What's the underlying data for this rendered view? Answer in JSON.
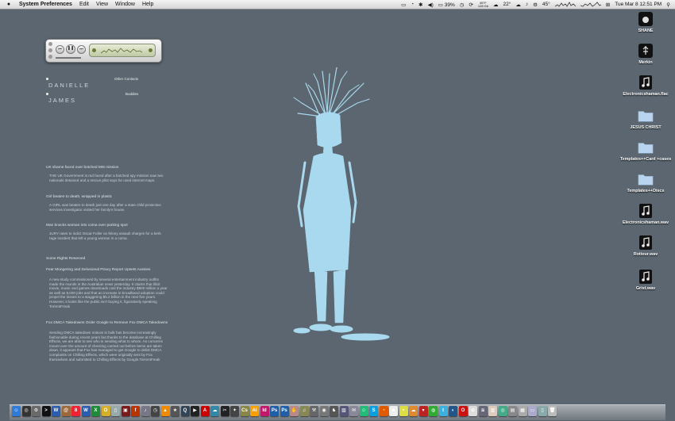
{
  "menubar": {
    "app_name": "System Preferences",
    "menus": [
      "Edit",
      "View",
      "Window",
      "Help"
    ],
    "battery_percent": "39%",
    "weather_temp": "22°",
    "temp_small": "45°",
    "clock": "Tue Mar 8  12:51 PM",
    "user_initial": "Q",
    "status_tiny_text": "85°F\n128 Gb"
  },
  "player": {
    "prev_label": "⏮",
    "play_label": "❚❚",
    "next_label": "⏭"
  },
  "contacts": [
    {
      "name": "DANIELLE",
      "group": "Other Contacts"
    },
    {
      "name": "JAMES",
      "group": "Buddies"
    }
  ],
  "news": [
    {
      "headline": "UK shame faced over botched MI6 mission",
      "body": "THE UK Government is red faced after a botched spy mission saw two nationals detained and a rescue pilot says he used internet maps."
    },
    {
      "headline": "Girl beaten to death, wrapped in plastic",
      "body": "A GIRL&nbsp;was beaten to death just one day after a state child protective services investigator visited her family's house."
    },
    {
      "headline": "Man knocks woman into coma over parking spot",
      "body": "JURY rates to indict Oscar Fuller on felony assault charges for a kerb rage incident that left a young woman in a coma."
    }
  ],
  "feed2": {
    "title": "Some Rights Reserved",
    "items": [
      {
        "headline": "Fear Mongering and Delusional Piracy Report Upsets Aussies",
        "body": "A new study commissioned by several entertainment industry outfits made the rounds in the Australian news yesterday. It claims that illicit movie, music and games downloads cost the industry $900 million a year as well as 8,000 jobs and that an increase in broadband adoption could propel the losses to a staggering $5.2 billion in the next five years. However, it looks like the public isn't buying it, figuratively speaking TorrentFreak"
      },
      {
        "headline": "Fox DMCA Takedowns Order Google to Remove Fox DMCA Takedowns",
        "body": "Sending DMCA takedown notices in bulk has become increasingly fashionable during recent years but thanks to the database at Chilling Effects, we are able to see who is sending what to whom. As concerns mount over the amount of checking carried out before items are taken down, it appears that Fox has managed to get Google to delist DMCA complaints on Chilling Effects, which were originally sent by Fox themselves and submitted to Chilling Effects by Google.TorrentFreak"
      }
    ]
  },
  "desktop_icons": [
    {
      "label": "SHANE",
      "icon": "apple-drive-icon"
    },
    {
      "label": "Merkin",
      "icon": "usb-drive-icon"
    },
    {
      "label": "Electronicshaman.flac",
      "icon": "audio-file-icon"
    },
    {
      "label": "JESUS CHRIST",
      "icon": "folder-icon"
    },
    {
      "label": "Templates++Card +cases",
      "icon": "folder-icon"
    },
    {
      "label": "Templates++Discs",
      "icon": "folder-icon"
    },
    {
      "label": "Electronicshaman.wav",
      "icon": "audio-file-icon"
    },
    {
      "label": "Rotteur.wav",
      "icon": "audio-file-icon"
    },
    {
      "label": "Grist.wav",
      "icon": "audio-file-icon"
    }
  ],
  "colors": {
    "desktop": "#5b6670",
    "figure": "#a9d9ee"
  },
  "dock": [
    {
      "name": "finder",
      "color": "#2f7bd8",
      "glyph": "☺"
    },
    {
      "name": "dashboard",
      "color": "#333",
      "glyph": "◎"
    },
    {
      "name": "system-preferences",
      "color": "#6a6a6a",
      "glyph": "⚙"
    },
    {
      "name": "terminal",
      "color": "#111",
      "glyph": ">"
    },
    {
      "name": "word",
      "color": "#2a5db0",
      "glyph": "W"
    },
    {
      "name": "address-book",
      "color": "#9c6a3a",
      "glyph": "@"
    },
    {
      "name": "ical",
      "color": "#e23",
      "glyph": "8"
    },
    {
      "name": "word-alt",
      "color": "#2a5db0",
      "glyph": "W"
    },
    {
      "name": "excel",
      "color": "#1f8a3a",
      "glyph": "X"
    },
    {
      "name": "ring",
      "color": "#d4b02a",
      "glyph": "O"
    },
    {
      "name": "ipod",
      "color": "#9aa",
      "glyph": "▯"
    },
    {
      "name": "photo-booth",
      "color": "#7a1a1a",
      "glyph": "▣"
    },
    {
      "name": "flash",
      "color": "#b30",
      "glyph": "f"
    },
    {
      "name": "itunes",
      "color": "#778",
      "glyph": "♪"
    },
    {
      "name": "time-machine",
      "color": "#444",
      "glyph": "◷"
    },
    {
      "name": "vlc",
      "color": "#f08a00",
      "glyph": "▲"
    },
    {
      "name": "imovie",
      "color": "#555",
      "glyph": "★"
    },
    {
      "name": "quicktime",
      "color": "#345",
      "glyph": "Q"
    },
    {
      "name": "app-dark",
      "color": "#222",
      "glyph": "▶"
    },
    {
      "name": "acrobat",
      "color": "#c00",
      "glyph": "A"
    },
    {
      "name": "skype-alt",
      "color": "#38a",
      "glyph": "☁"
    },
    {
      "name": "cut-app",
      "color": "#222",
      "glyph": "✂"
    },
    {
      "name": "star-app",
      "color": "#444",
      "glyph": "✦"
    },
    {
      "name": "cs-app",
      "color": "#884",
      "glyph": "Cs"
    },
    {
      "name": "illustrator",
      "color": "#f7a000",
      "glyph": "Ai"
    },
    {
      "name": "indesign",
      "color": "#c2186a",
      "glyph": "Id"
    },
    {
      "name": "photoshop",
      "color": "#1f5fa8",
      "glyph": "Ps"
    },
    {
      "name": "photoshop-2",
      "color": "#1f5fa8",
      "glyph": "Ps"
    },
    {
      "name": "hand-app",
      "color": "#b88",
      "glyph": "✋"
    },
    {
      "name": "guitar-app",
      "color": "#885",
      "glyph": "♫"
    },
    {
      "name": "tools-app",
      "color": "#666",
      "glyph": "⚒"
    },
    {
      "name": "disk-utility",
      "color": "#777",
      "glyph": "◉"
    },
    {
      "name": "chess-app",
      "color": "#555",
      "glyph": "♞"
    },
    {
      "name": "preview",
      "color": "#557",
      "glyph": "▧"
    },
    {
      "name": "mail-app",
      "color": "#889",
      "glyph": "✉"
    },
    {
      "name": "ichat",
      "color": "#2b7",
      "glyph": "☺"
    },
    {
      "name": "skype",
      "color": "#0aa0e0",
      "glyph": "S"
    },
    {
      "name": "firefox",
      "color": "#e05a00",
      "glyph": "◔"
    },
    {
      "name": "panda-app",
      "color": "#eee",
      "glyph": "☻"
    },
    {
      "name": "burn-app",
      "color": "#dd4",
      "glyph": "◓"
    },
    {
      "name": "cloud-app",
      "color": "#e08a30",
      "glyph": "☁"
    },
    {
      "name": "transmission",
      "color": "#b22",
      "glyph": "▾"
    },
    {
      "name": "app-green",
      "color": "#3a3",
      "glyph": "◍"
    },
    {
      "name": "twitter",
      "color": "#3ab0e0",
      "glyph": "t"
    },
    {
      "name": "app-blue",
      "color": "#258",
      "glyph": "◐"
    },
    {
      "name": "opera",
      "color": "#c11",
      "glyph": "O"
    },
    {
      "name": "app-white",
      "color": "#ddd",
      "glyph": "✿"
    },
    {
      "name": "scroll-app",
      "color": "#667",
      "glyph": "≋"
    },
    {
      "name": "sticky-app",
      "color": "#dcb",
      "glyph": "▥"
    },
    {
      "name": "chrome-alt",
      "color": "#4a8",
      "glyph": "◎"
    },
    {
      "name": "app-gray",
      "color": "#888",
      "glyph": "▤"
    },
    {
      "name": "calendar-grid",
      "color": "#aaa",
      "glyph": "▦"
    },
    {
      "name": "notes-app",
      "color": "#aac",
      "glyph": "▭"
    },
    {
      "name": "downloads-stack",
      "color": "#8aa",
      "glyph": "▯"
    },
    {
      "name": "trash",
      "color": "#bbb",
      "glyph": "🗑"
    }
  ]
}
